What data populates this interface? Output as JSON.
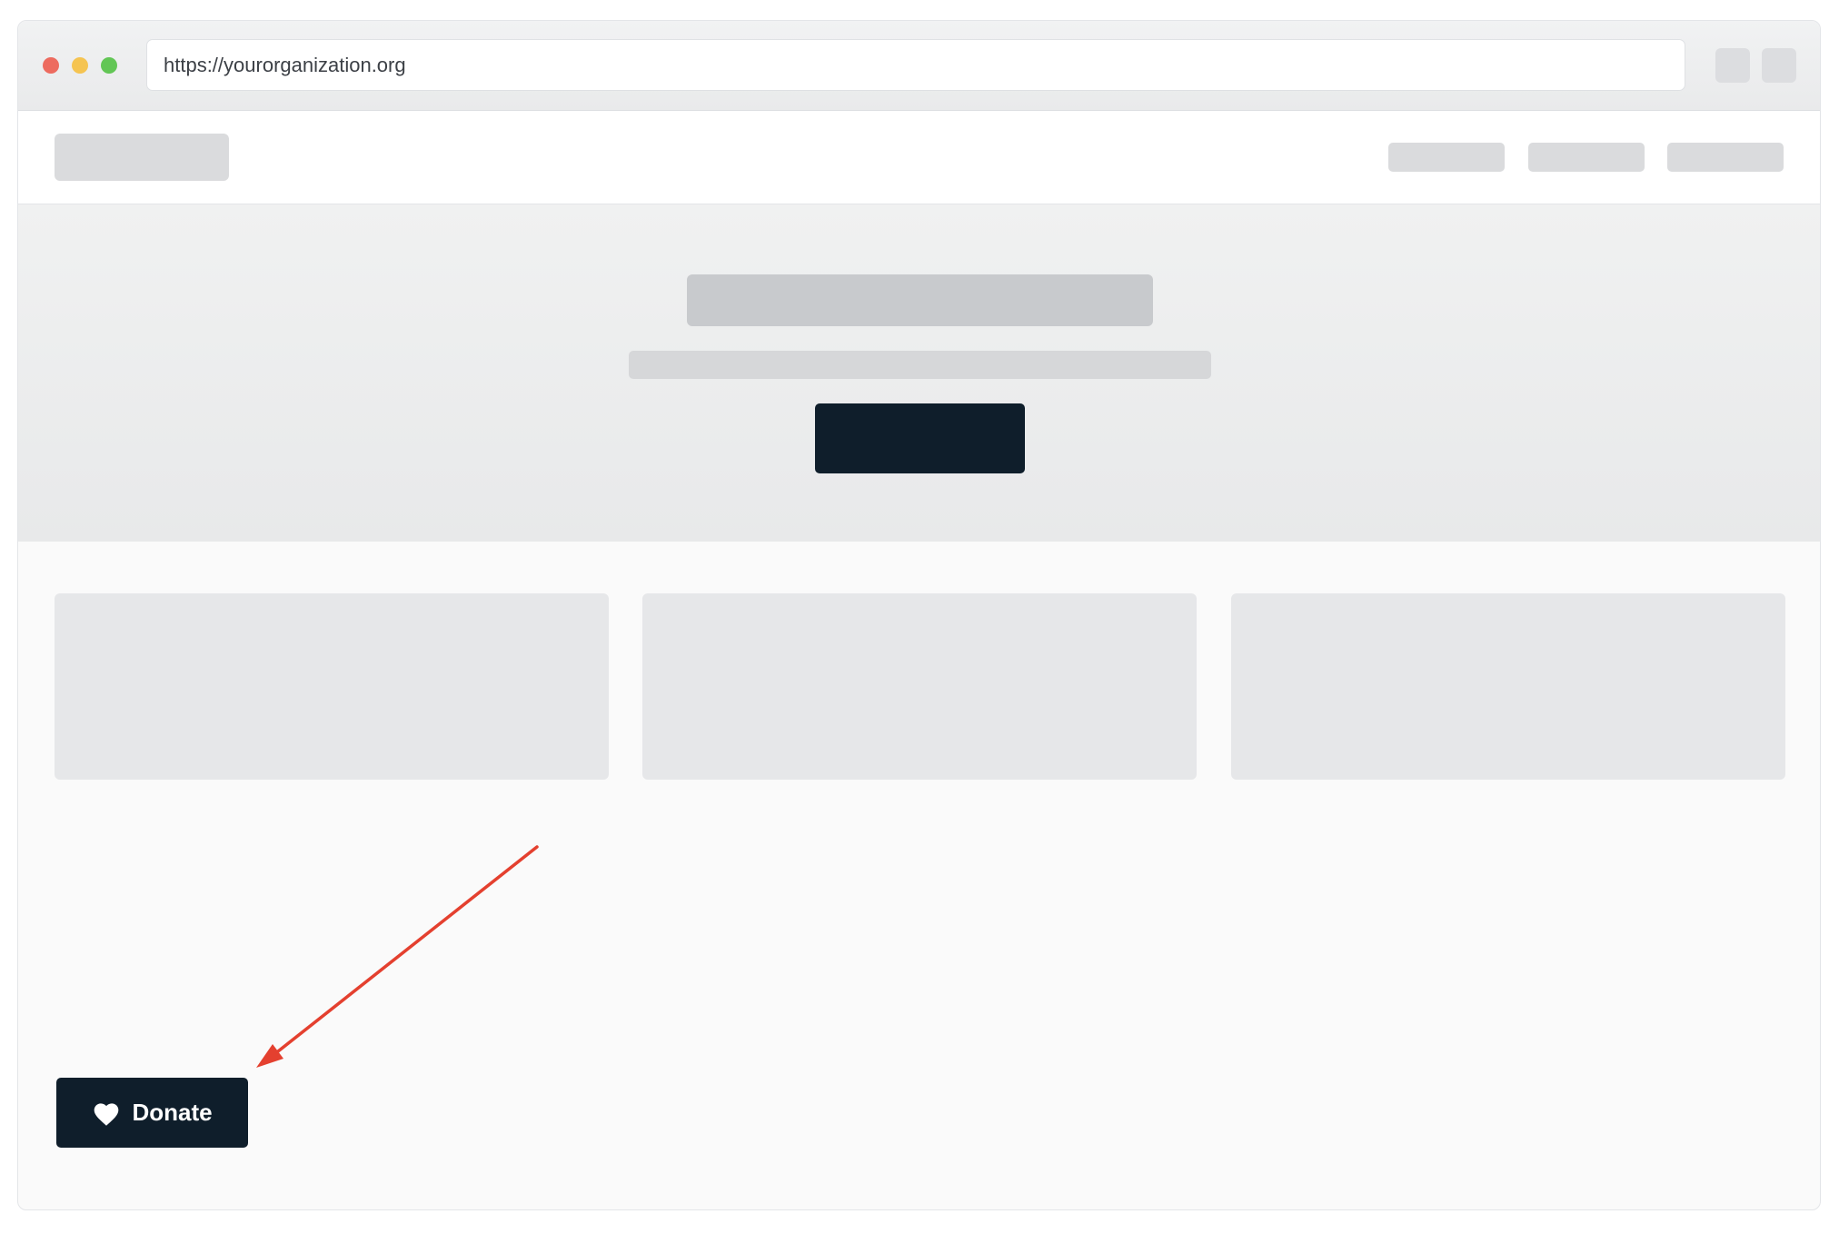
{
  "browser": {
    "url": "https://yourorganization.org",
    "traffic_lights": {
      "close": "#ed6b5f",
      "minimize": "#f5c451",
      "maximize": "#62c655"
    }
  },
  "donate_button": {
    "label": "Donate",
    "icon": "heart-icon",
    "background": "#0f1e2b"
  },
  "annotation": {
    "arrow_color": "#e4402f",
    "points_to": "donate-button"
  }
}
